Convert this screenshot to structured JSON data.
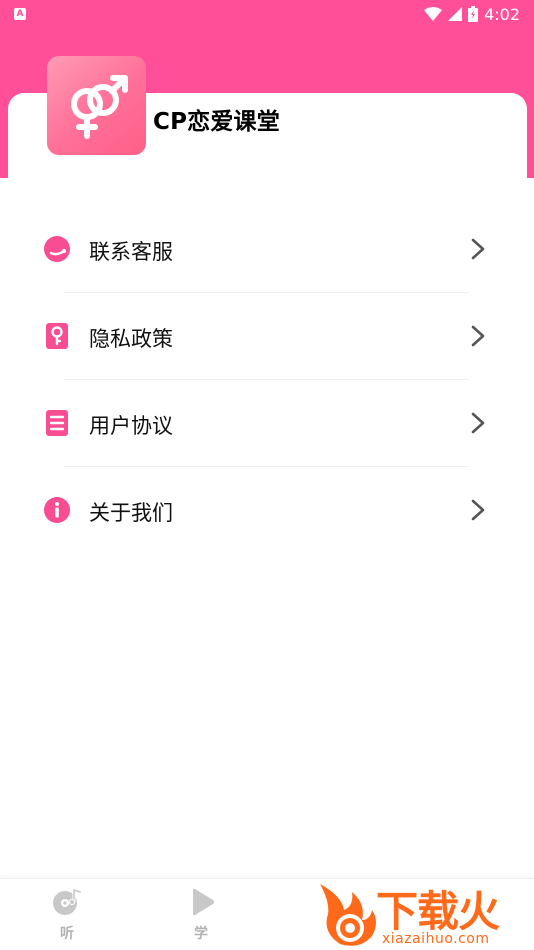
{
  "status_bar": {
    "time": "4:02",
    "app_icon_letter": "A"
  },
  "profile": {
    "app_name": "CP恋爱课堂",
    "logo_icon": "gender-symbols-icon"
  },
  "menu": {
    "items": [
      {
        "label": "联系客服",
        "icon": "customer-service-icon"
      },
      {
        "label": "隐私政策",
        "icon": "privacy-lock-icon"
      },
      {
        "label": "用户协议",
        "icon": "document-icon"
      },
      {
        "label": "关于我们",
        "icon": "info-icon"
      }
    ]
  },
  "bottom_nav": {
    "tabs": [
      {
        "label": "听",
        "icon": "music-disc-icon"
      },
      {
        "label": "学",
        "icon": "play-icon"
      }
    ]
  },
  "watermark": {
    "text": "下载火",
    "url": "xiazaihuo.com"
  },
  "colors": {
    "accent": "#ff4f98",
    "logo_gradient_start": "#ff9ab5",
    "logo_gradient_end": "#ff5f88",
    "icon_pink": "#f84d92",
    "tab_gray": "#b3b3b3",
    "watermark_orange": "#ff6a1a"
  }
}
